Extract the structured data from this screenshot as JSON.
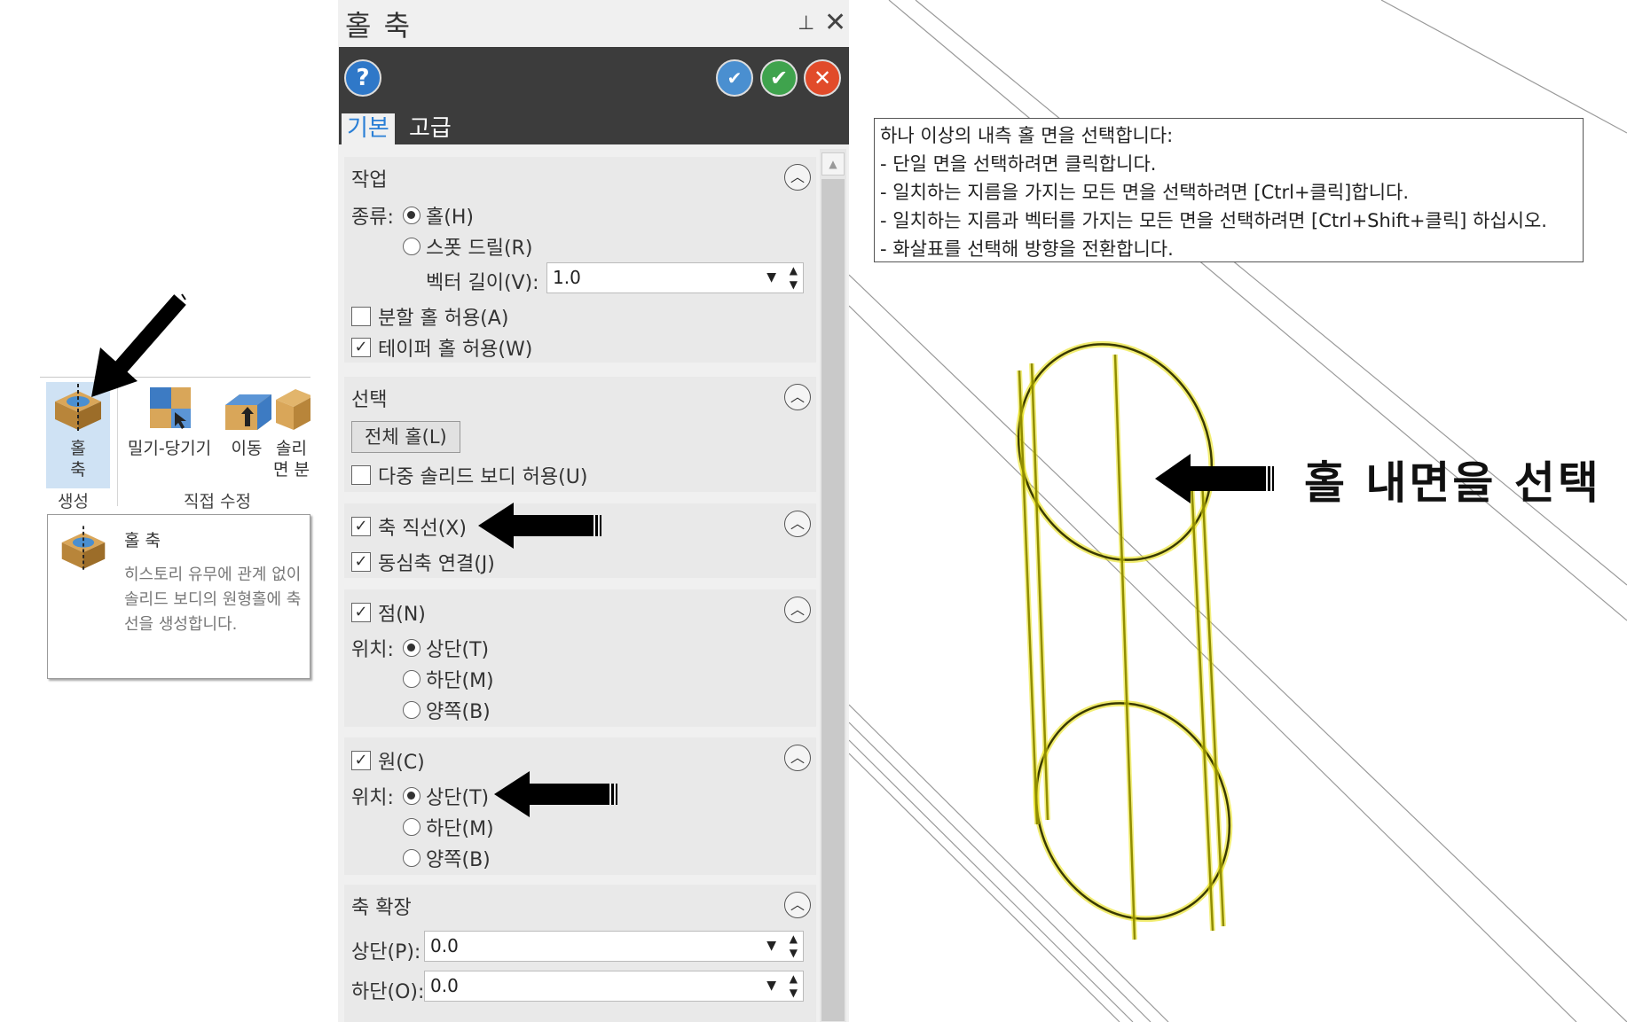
{
  "ribbon": {
    "hole_axis_label_line1": "홀",
    "hole_axis_label_line2": "축",
    "push_pull_label": "밀기-당기기",
    "move_label": "이동",
    "solid_face_line1": "솔리",
    "solid_face_line2": "면 분",
    "group_create": "생성",
    "group_direct_edit": "직접 수정"
  },
  "tooltip": {
    "title": "홀 축",
    "description": "히스토리 유무에 관계 없이 솔리드 보디의 원형홀에 축 선을 생성합니다."
  },
  "panel": {
    "title": "홀 축",
    "tabs": [
      "기본",
      "고급"
    ],
    "task": {
      "header": "작업",
      "type_label": "종류:",
      "hole_option": "홀(H)",
      "spot_drill_option": "스폿 드릴(R)",
      "vector_length_label": "벡터 길이(V):",
      "vector_length_value": "1.0",
      "allow_split_hole": "분할 홀 허용(A)",
      "allow_taper_hole": "테이퍼 홀 허용(W)"
    },
    "selection": {
      "header": "선택",
      "all_holes_button": "전체 홀(L)",
      "allow_multi_solid": "다중 솔리드 보디 허용(U)"
    },
    "axis": {
      "axis_line": "축 직선(X)",
      "concentric_link": "동심축 연결(J)"
    },
    "point": {
      "header": "점(N)",
      "position_label": "위치:",
      "top": "상단(T)",
      "bottom": "하단(M)",
      "both": "양쪽(B)"
    },
    "circle": {
      "header": "원(C)",
      "position_label": "위치:",
      "top": "상단(T)",
      "bottom": "하단(M)",
      "both": "양쪽(B)"
    },
    "extension": {
      "header": "축 확장",
      "top_label": "상단(P):",
      "top_value": "0.0",
      "bottom_label": "하단(O):",
      "bottom_value": "0.0"
    }
  },
  "viewport": {
    "hint_lines": [
      "하나 이상의 내측 홀 면을 선택합니다:",
      "- 단일 면을 선택하려면 클릭합니다.",
      "- 일치하는 지름을 가지는 모든 면을 선택하려면 [Ctrl+클릭]합니다.",
      "- 일치하는 지름과 벡터를 가지는 모든 면을 선택하려면 [Ctrl+Shift+클릭] 하십시오.",
      "- 화살표를 선택해 방향을 전환합니다."
    ],
    "annotation": "홀 내면을 선택"
  },
  "colors": {
    "accent_blue": "#2a7fd6",
    "toolbar_dark": "#3c3c3c",
    "highlight_yellow": "#e8e000",
    "ok_green": "#3fa34d",
    "cancel_red": "#e14b2a"
  }
}
